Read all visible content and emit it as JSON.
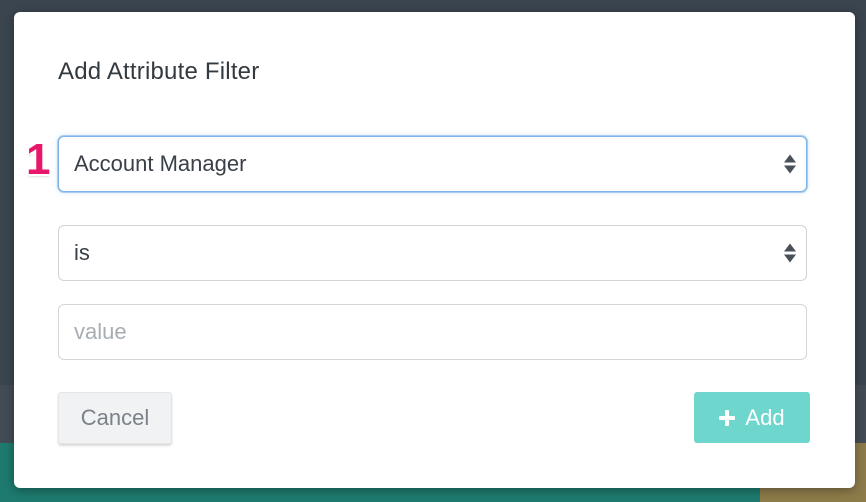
{
  "modal": {
    "title": "Add Attribute Filter"
  },
  "step_marker": "1",
  "attribute_select": {
    "selected": "Account Manager"
  },
  "operator_select": {
    "selected": "is"
  },
  "value_input": {
    "value": "",
    "placeholder": "value"
  },
  "buttons": {
    "cancel_label": "Cancel",
    "add_label": "Add"
  },
  "icons": {
    "add": "plus-icon",
    "select": "sort-arrows-icon"
  },
  "colors": {
    "add_button": "#6fd6ce",
    "focus_ring": "#7fb4e8",
    "step_marker": "#e8176b"
  }
}
